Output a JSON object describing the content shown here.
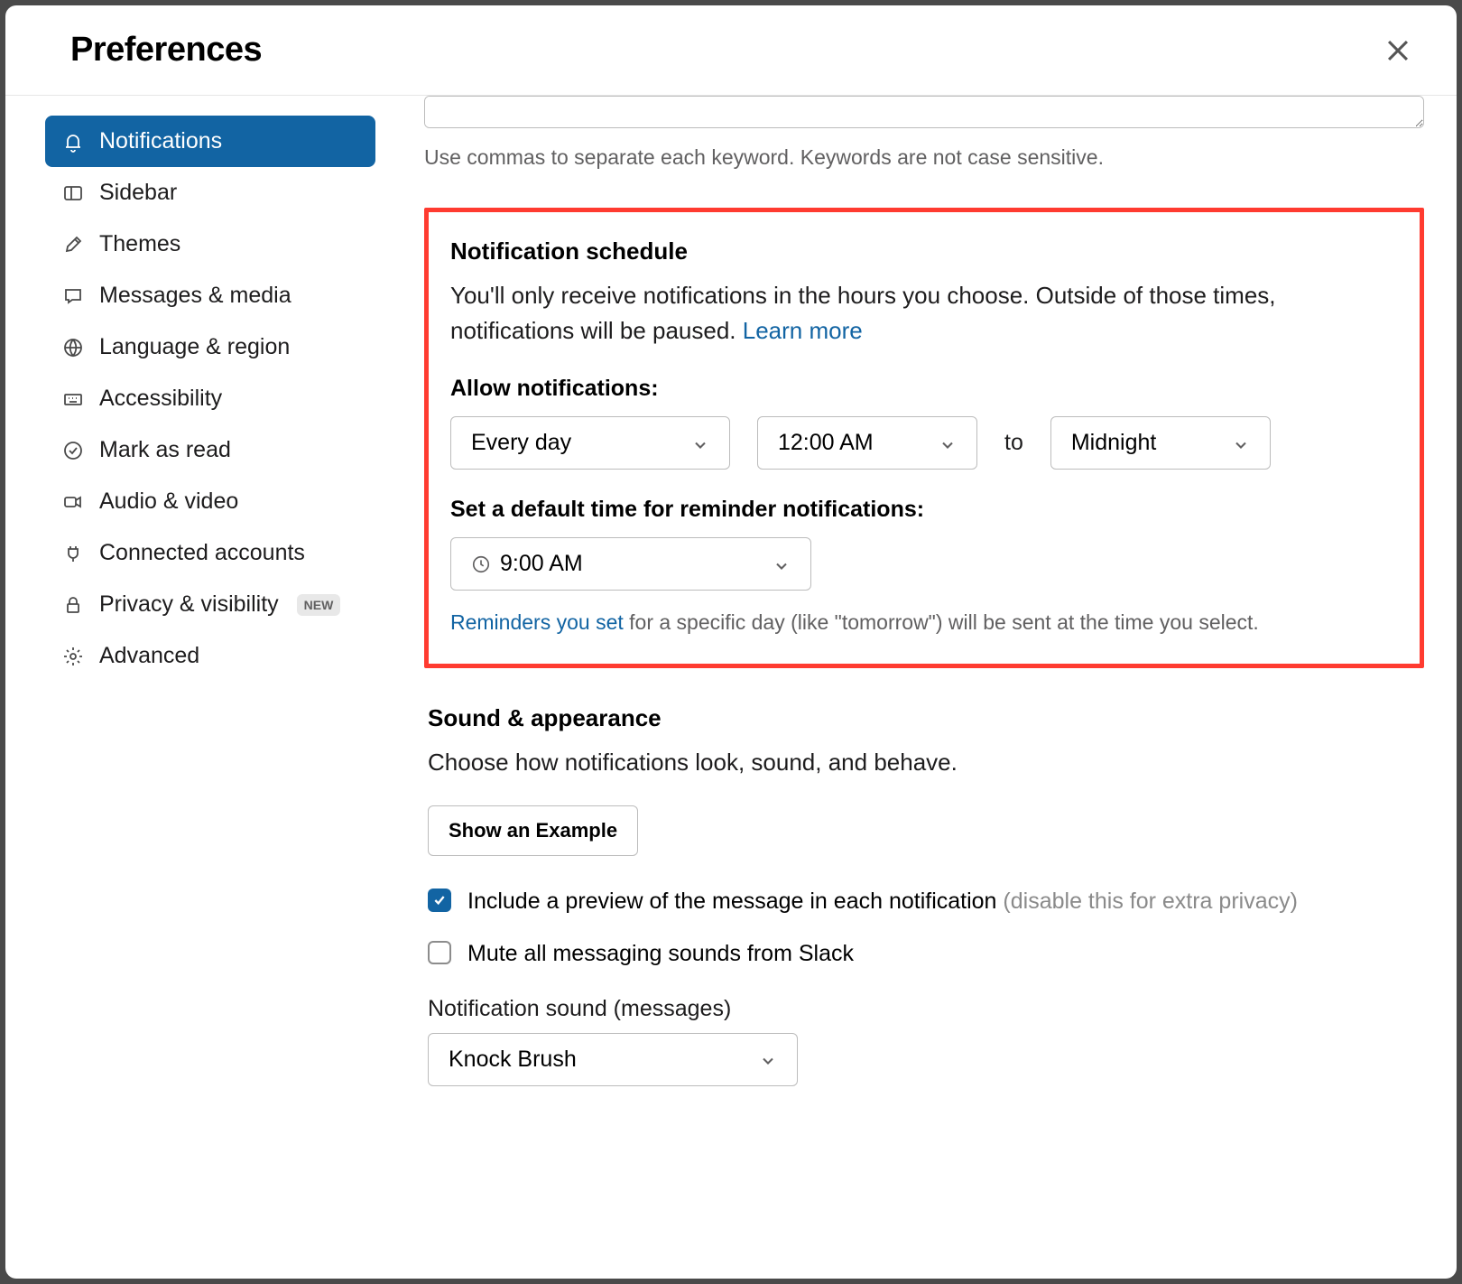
{
  "header": {
    "title": "Preferences"
  },
  "sidebar": {
    "items": [
      {
        "label": "Notifications",
        "active": true
      },
      {
        "label": "Sidebar"
      },
      {
        "label": "Themes"
      },
      {
        "label": "Messages & media"
      },
      {
        "label": "Language & region"
      },
      {
        "label": "Accessibility"
      },
      {
        "label": "Mark as read"
      },
      {
        "label": "Audio & video"
      },
      {
        "label": "Connected accounts"
      },
      {
        "label": "Privacy & visibility",
        "badge": "NEW"
      },
      {
        "label": "Advanced"
      }
    ]
  },
  "keywords": {
    "helper": "Use commas to separate each keyword. Keywords are not case sensitive."
  },
  "schedule": {
    "title": "Notification schedule",
    "desc": "You'll only receive notifications in the hours you choose. Outside of those times, notifications will be paused. ",
    "learn_more": "Learn more",
    "allow_label": "Allow notifications:",
    "frequency": "Every day",
    "start_time": "12:00 AM",
    "to": "to",
    "end_time": "Midnight",
    "default_label": "Set a default time for reminder notifications:",
    "default_time": "9:00 AM",
    "hint_link": "Reminders you set",
    "hint_rest": " for a specific day (like \"tomorrow\") will be sent at the time you select."
  },
  "sound": {
    "title": "Sound & appearance",
    "desc": "Choose how notifications look, sound, and behave.",
    "example_btn": "Show an Example",
    "preview_label": "Include a preview of the message in each notification ",
    "preview_muted": "(disable this for extra privacy)",
    "mute_label": "Mute all messaging sounds from Slack",
    "sound_label": "Notification sound (messages)",
    "sound_value": "Knock Brush"
  }
}
